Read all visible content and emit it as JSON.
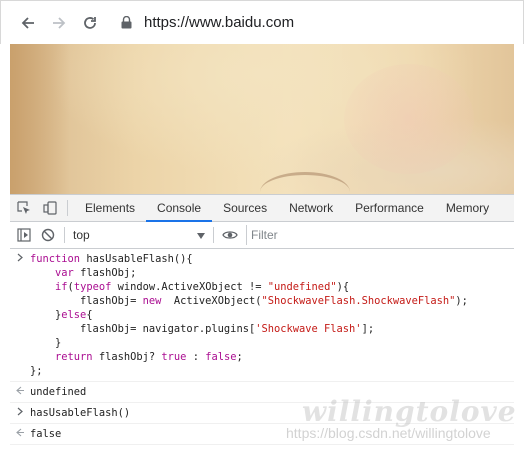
{
  "browser": {
    "url": "https://www.baidu.com",
    "icons": [
      "back-arrow-icon",
      "forward-arrow-icon",
      "reload-icon",
      "lock-icon"
    ]
  },
  "devtools": {
    "tabs": [
      {
        "label": "Elements"
      },
      {
        "label": "Console",
        "active": true
      },
      {
        "label": "Sources"
      },
      {
        "label": "Network"
      },
      {
        "label": "Performance"
      },
      {
        "label": "Memory"
      }
    ],
    "toolbar": {
      "context": "top",
      "filter_placeholder": "Filter"
    },
    "console": {
      "function_code": [
        "function hasUsableFlash(){",
        "    var flashObj;",
        "    if(typeof window.ActiveXObject != \"undefined\"){",
        "        flashObj= new  ActiveXObject(\"ShockwaveFlash.ShockwaveFlash\");",
        "    }else{",
        "        flashObj= navigator.plugins['Shockwave Flash'];",
        "    }",
        "    return flashObj? true : false;",
        "};"
      ],
      "result1": "undefined",
      "command2": "hasUsableFlash()",
      "result2": "false"
    }
  },
  "watermark": {
    "text": "willingtolove",
    "url": "https://blog.csdn.net/willingtolove"
  },
  "colors": {
    "accent": "#1a73e8",
    "keyword": "#aa0d91",
    "string": "#c41a16",
    "boolean": "#1a1aa6"
  }
}
